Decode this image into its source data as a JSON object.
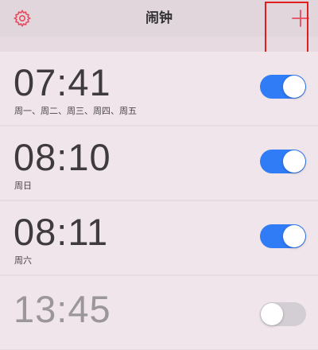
{
  "header": {
    "title": "闹钟",
    "settings_icon": "gear-icon",
    "add_icon": "plus-icon"
  },
  "alarms": [
    {
      "time": "07:41",
      "days": "周一、周二、周三、周四、周五",
      "enabled": true
    },
    {
      "time": "08:10",
      "days": "周日",
      "enabled": true
    },
    {
      "time": "08:11",
      "days": "周六",
      "enabled": true
    },
    {
      "time": "13:45",
      "days": "",
      "enabled": false
    }
  ],
  "colors": {
    "accent": "#2f7cf6",
    "icon_red": "#e84a5f",
    "highlight": "#e01e1e"
  }
}
